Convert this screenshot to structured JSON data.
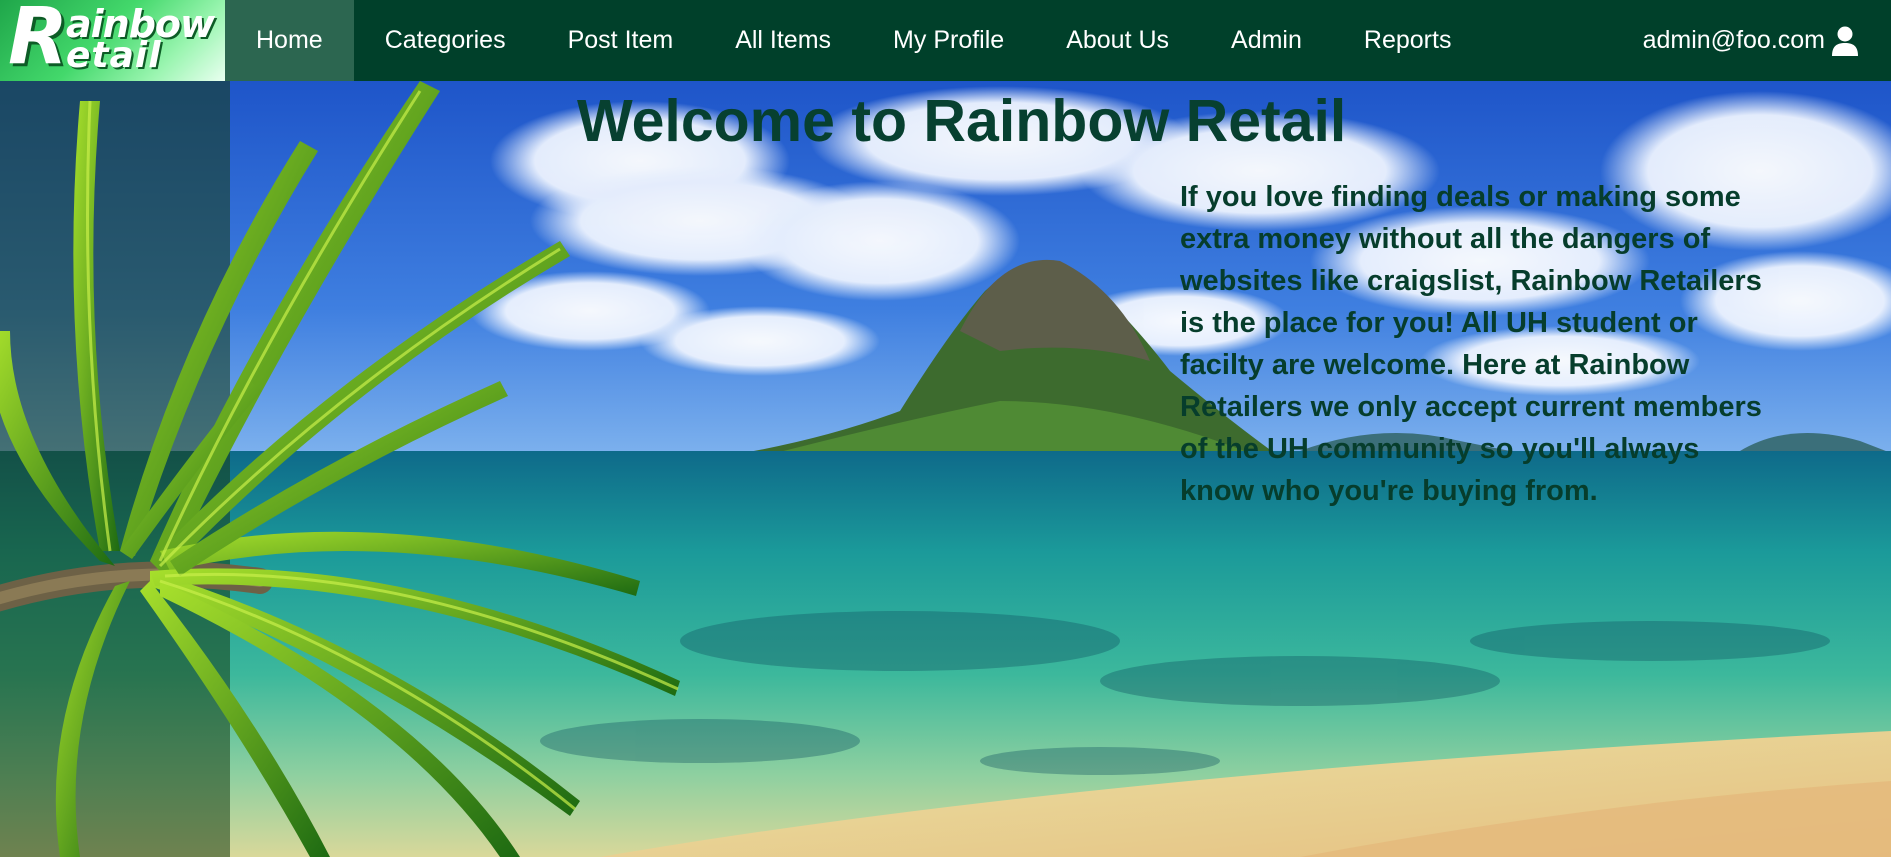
{
  "brand": {
    "name": "Rainbow Retail",
    "logo_letter": "R",
    "logo_line1": "ainbow",
    "logo_line2": "etail"
  },
  "nav": {
    "items": [
      {
        "label": "Home",
        "active": true
      },
      {
        "label": "Categories"
      },
      {
        "label": "Post Item"
      },
      {
        "label": "All Items"
      },
      {
        "label": "My Profile"
      },
      {
        "label": "About Us"
      },
      {
        "label": "Admin"
      },
      {
        "label": "Reports"
      }
    ],
    "user_email": "admin@foo.com",
    "user_icon": "user-icon"
  },
  "hero": {
    "title": "Welcome to Rainbow Retail",
    "body": "If you love finding deals or making some extra money without all the dangers of websites like craigslist, Rainbow Retailers is the place for you! All UH student or facilty are welcome. Here at Rainbow Retailers we only accept current members of the UH community so you'll always know who you're buying from."
  },
  "colors": {
    "navbar": "#00402a",
    "nav_active": "#2c6650",
    "title_text": "#074030"
  }
}
